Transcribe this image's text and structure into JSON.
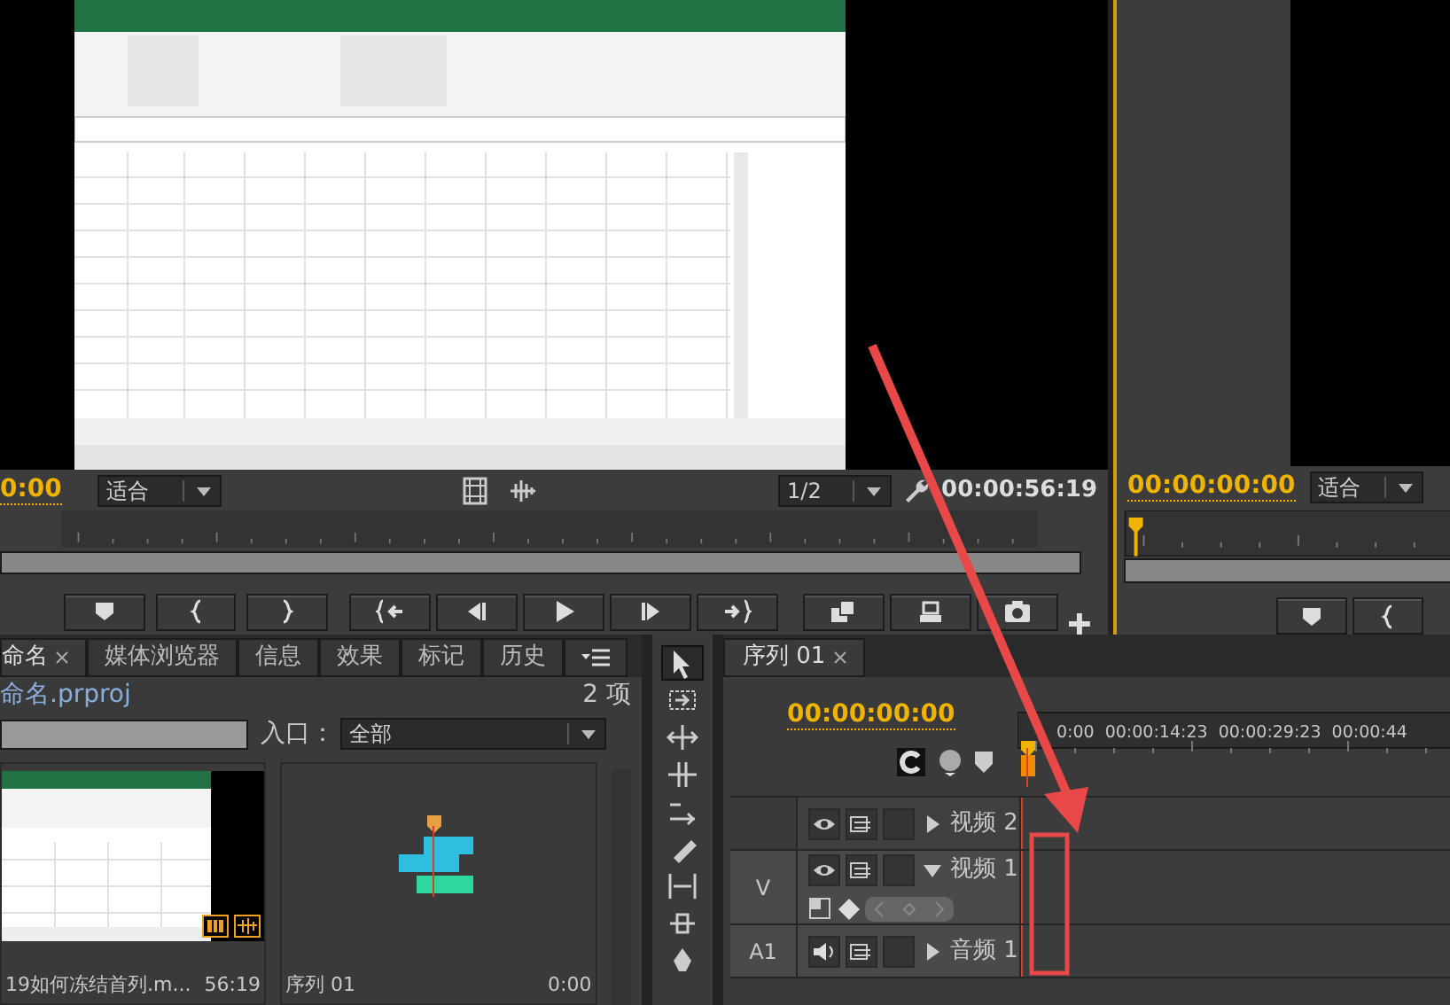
{
  "source_monitor": {
    "timecode": "0:00",
    "zoom": "适合",
    "ratio": "1/2",
    "duration": "00:00:56:19"
  },
  "program_monitor": {
    "timecode": "00:00:00:00",
    "zoom": "适合"
  },
  "project_panel": {
    "tabs": [
      {
        "label": "命名",
        "selected": true,
        "closable": true
      },
      {
        "label": "媒体浏览器",
        "selected": false,
        "closable": false
      },
      {
        "label": "信息",
        "selected": false,
        "closable": false
      },
      {
        "label": "效果",
        "selected": false,
        "closable": false
      },
      {
        "label": "标记",
        "selected": false,
        "closable": false
      },
      {
        "label": "历史",
        "selected": false,
        "closable": false
      }
    ],
    "project_name": "命名.prproj",
    "item_count": "2 项",
    "entry_label": "入口：",
    "entry_value": "全部",
    "items": [
      {
        "kind": "clip",
        "name": "19如何冻结首列.m...",
        "duration": "56:19"
      },
      {
        "kind": "sequence",
        "name": "序列 01",
        "duration": "0:00"
      }
    ]
  },
  "timeline": {
    "tab": "序列 01",
    "timecode": "00:00:00:00",
    "ruler": [
      "0:00",
      "00:00:14:23",
      "00:00:29:23",
      "00:00:44"
    ],
    "tracks": [
      {
        "kind": "video",
        "name": "视频 2",
        "expanded": false
      },
      {
        "kind": "video",
        "target": "V",
        "name": "视频 1",
        "expanded": true
      },
      {
        "kind": "audio",
        "target": "A1",
        "name": "音频 1",
        "expanded": false
      }
    ]
  }
}
